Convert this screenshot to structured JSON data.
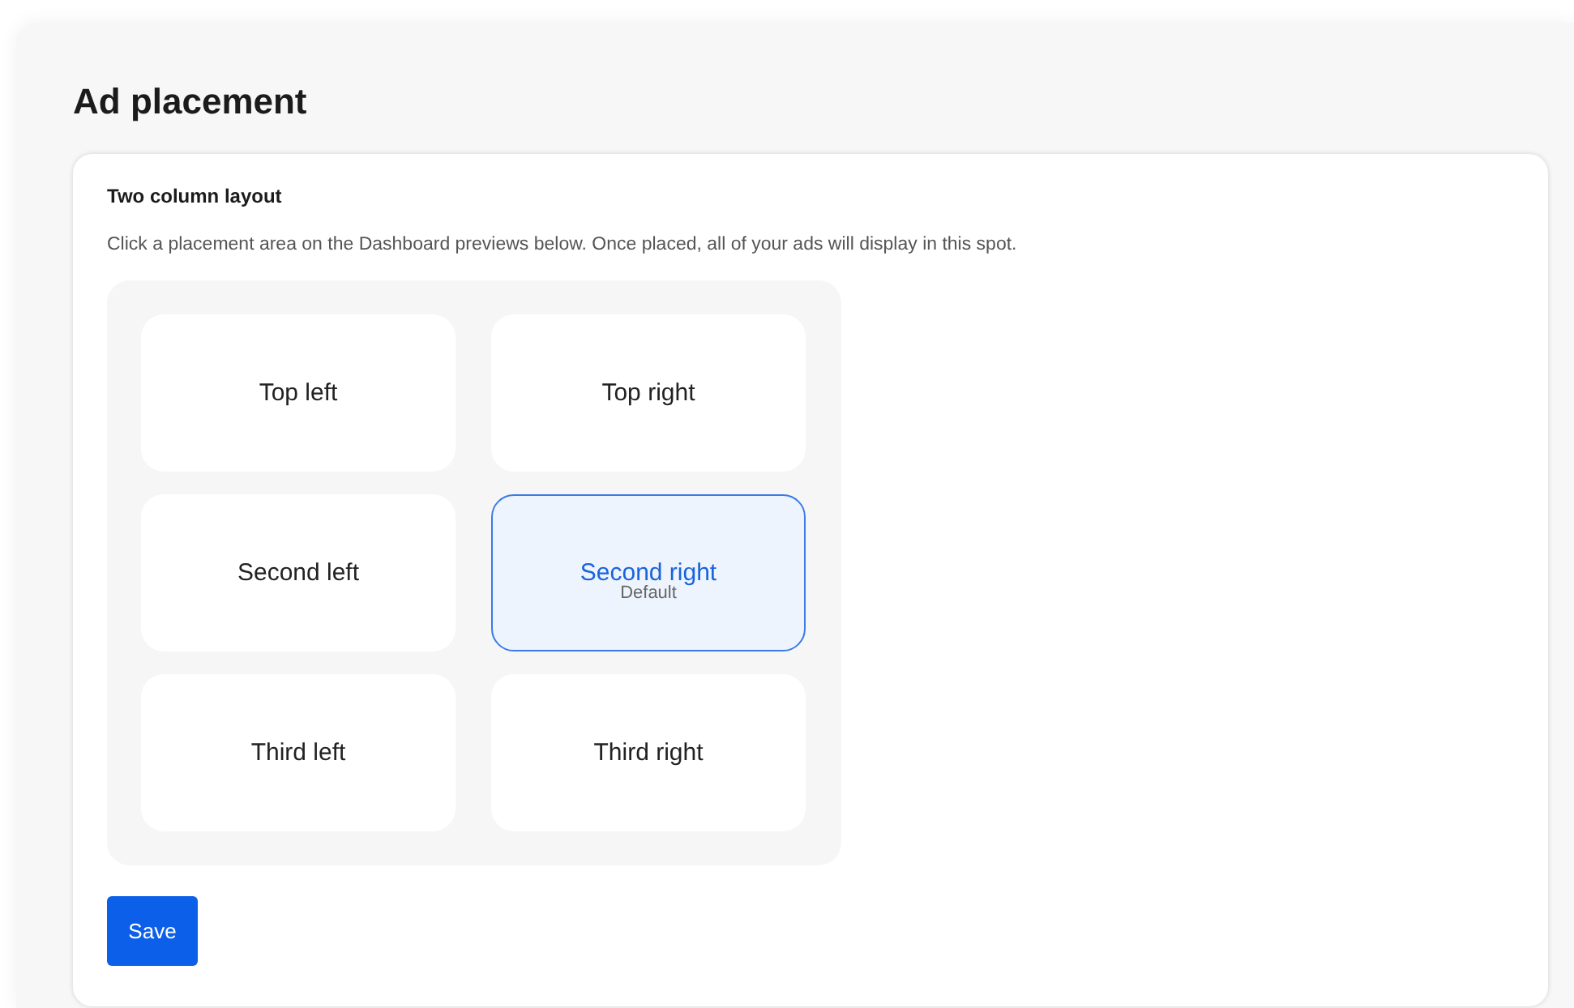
{
  "page": {
    "title": "Ad placement"
  },
  "card": {
    "heading": "Two column layout",
    "description": "Click a placement area on the Dashboard previews below. Once placed, all of your ads will display in this spot.",
    "placements": [
      {
        "label": "Top left",
        "selected": false
      },
      {
        "label": "Top right",
        "selected": false
      },
      {
        "label": "Second left",
        "selected": false
      },
      {
        "label": "Second right",
        "selected": true,
        "note": "Default"
      },
      {
        "label": "Third left",
        "selected": false
      },
      {
        "label": "Third right",
        "selected": false
      }
    ],
    "save_button": "Save"
  }
}
